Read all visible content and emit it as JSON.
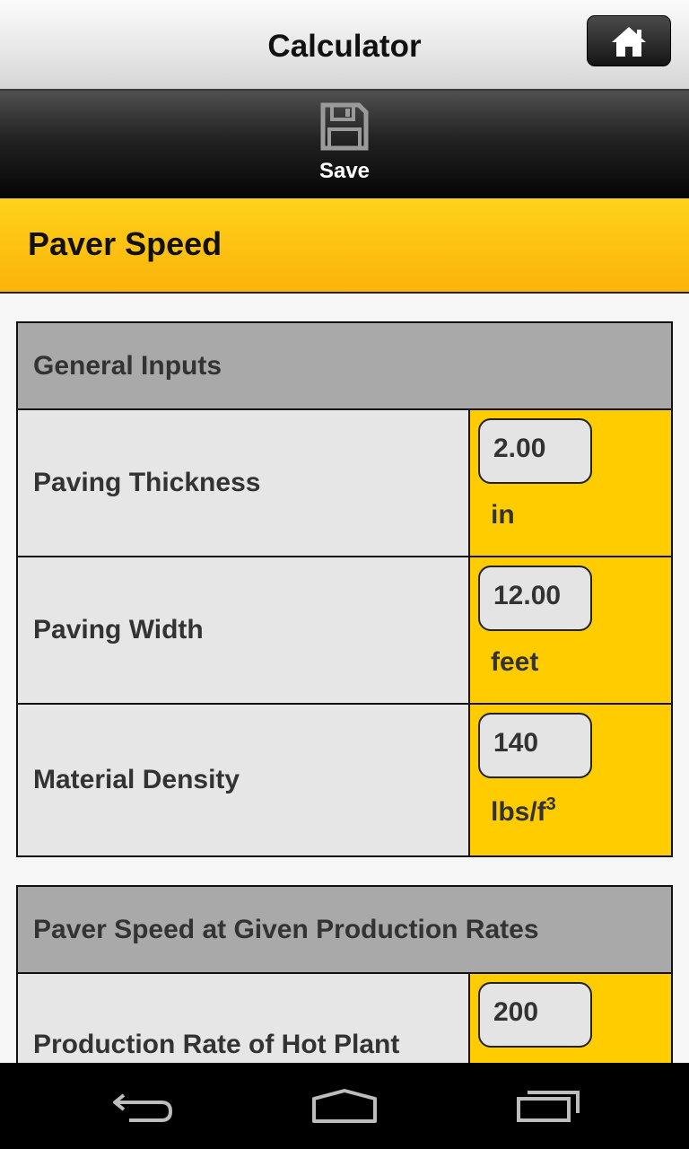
{
  "app": {
    "title": "Calculator",
    "home_icon": "home-icon"
  },
  "toolbar": {
    "save_label": "Save",
    "save_icon": "floppy-disk-icon"
  },
  "page": {
    "heading": "Paver Speed"
  },
  "general_inputs": {
    "title": "General Inputs",
    "rows": [
      {
        "label": "Paving Thickness",
        "value": "2.00",
        "unit": "in"
      },
      {
        "label": "Paving Width",
        "value": "12.00",
        "unit": "feet"
      },
      {
        "label": "Material Density",
        "value": "140",
        "unit_base": "lbs/f",
        "unit_sup": "3"
      }
    ]
  },
  "production": {
    "title": "Paver Speed at Given Production Rates",
    "rows": [
      {
        "label": "Production Rate of Hot Plant",
        "value": "200"
      }
    ]
  },
  "navbar": {
    "icons": [
      "back-icon",
      "home-nav-icon",
      "recents-icon"
    ]
  },
  "colors": {
    "accent": "#ffcc00",
    "header_gray": "#a9a9a9",
    "cell_gray": "#e6e6e6"
  }
}
